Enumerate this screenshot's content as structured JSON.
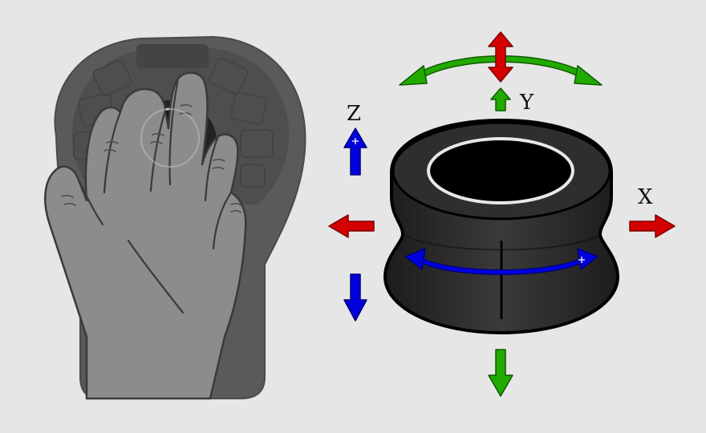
{
  "axes": {
    "x": {
      "label": "X",
      "color": "#d40000"
    },
    "y": {
      "label": "Y",
      "color": "#22aa00"
    },
    "z": {
      "label": "Z",
      "color": "#0000dd"
    }
  },
  "colors": {
    "background": "#e6e6e6",
    "device_body": "#2b2b2b",
    "device_outline": "#000000",
    "cap_ring": "#e8e8e8",
    "hand": "#8c8c8c",
    "hand_outline": "#3a3a3a",
    "base": "#5a5a5a"
  },
  "icons": {
    "hand": "hand-on-controller",
    "controller": "3d-mouse-cap",
    "arrow": "arrow"
  }
}
